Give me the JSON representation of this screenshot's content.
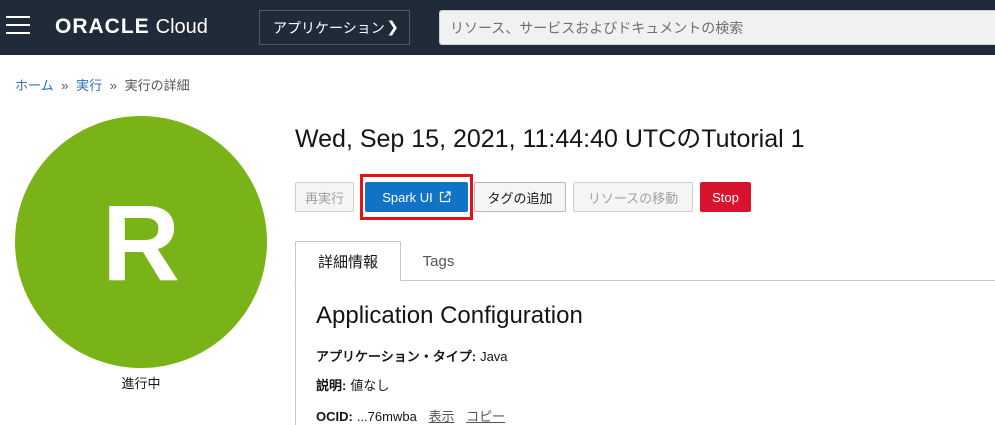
{
  "header": {
    "brand_oracle": "ORACLE",
    "brand_cloud": "Cloud",
    "app_button_label": "アプリケーション",
    "app_button_chevron": "❯",
    "search_placeholder": "リソース、サービスおよびドキュメントの検索"
  },
  "breadcrumb": {
    "home": "ホーム",
    "runs": "実行",
    "current": "実行の詳細",
    "separator": "»"
  },
  "avatar": {
    "letter": "R",
    "color": "#7ab317",
    "status": "進行中"
  },
  "page_title": "Wed, Sep 15, 2021, 11:44:40 UTCのTutorial 1",
  "actions": {
    "rerun": "再実行",
    "spark_ui": "Spark UI",
    "add_tags": "タグの追加",
    "move_resource": "リソースの移動",
    "stop": "Stop"
  },
  "tabs": {
    "details": "詳細情報",
    "tags": "Tags"
  },
  "details": {
    "section_title": "Application Configuration",
    "app_type_label": "アプリケーション・タイプ:",
    "app_type_value": "Java",
    "description_label": "説明:",
    "description_value": "値なし",
    "ocid_label": "OCID:",
    "ocid_value": "...76mwba",
    "ocid_show": "表示",
    "ocid_copy": "コピー"
  },
  "colors": {
    "topbar": "#1f2b38",
    "primary": "#0f73c6",
    "danger": "#d7132d",
    "highlight": "#e2131c",
    "link": "#2c6fb5"
  }
}
